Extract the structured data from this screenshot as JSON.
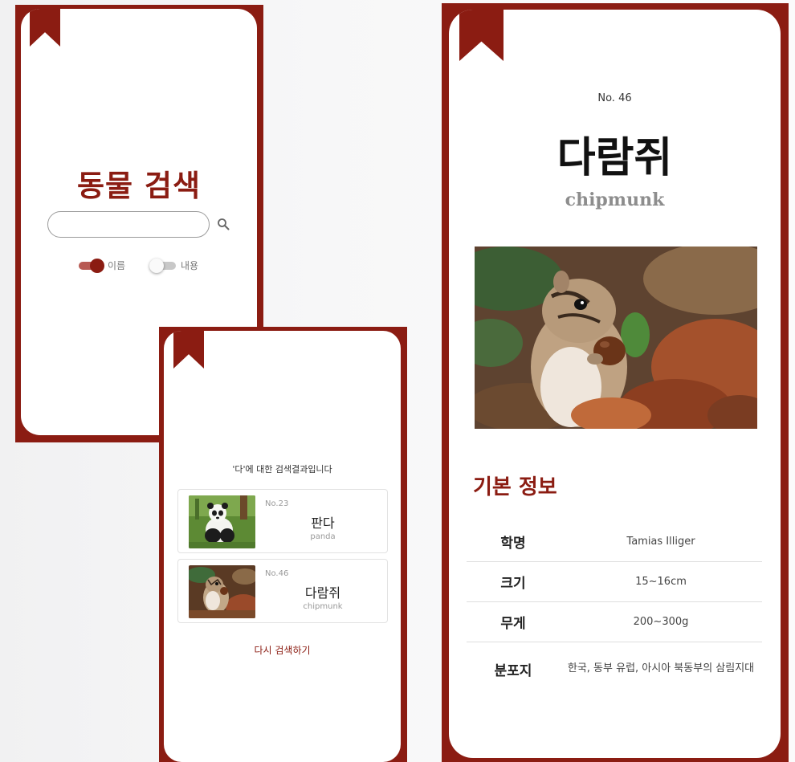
{
  "search_screen": {
    "title": "동물 검색",
    "search_input": {
      "value": "",
      "placeholder": ""
    },
    "toggles": [
      {
        "label": "이름",
        "state": "on"
      },
      {
        "label": "내용",
        "state": "off"
      }
    ]
  },
  "results_screen": {
    "caption": "'다'에 대한 검색결과입니다",
    "results": [
      {
        "no": "No.23",
        "name_ko": "판다",
        "name_en": "panda",
        "icon": "panda-photo"
      },
      {
        "no": "No.46",
        "name_ko": "다람쥐",
        "name_en": "chipmunk",
        "icon": "chipmunk-photo"
      }
    ],
    "retry_label": "다시 검색하기"
  },
  "detail_screen": {
    "no": "No. 46",
    "name_ko": "다람쥐",
    "name_en": "chipmunk",
    "section_title": "기본 정보",
    "info": [
      {
        "label": "학명",
        "value": "Tamias Illiger"
      },
      {
        "label": "크기",
        "value": "15~16cm"
      },
      {
        "label": "무게",
        "value": "200~300g"
      },
      {
        "label": "분포지",
        "value": "한국, 동부 유럽, 아시아 북동부의 삼림지대"
      }
    ]
  },
  "colors": {
    "brand": "#8b1c12",
    "toggle_track_on": "#b85a53",
    "muted_text": "#8d8d8d"
  },
  "icons": [
    "bookmark-icon",
    "search-icon"
  ]
}
